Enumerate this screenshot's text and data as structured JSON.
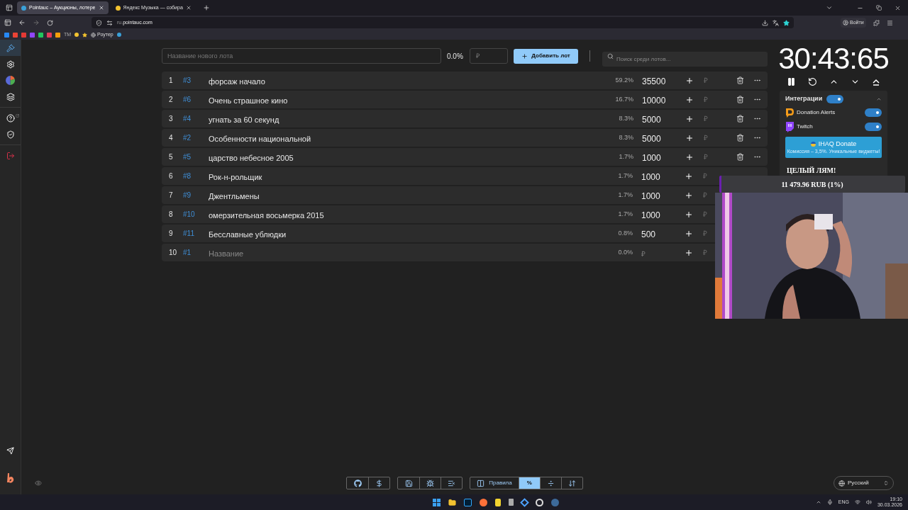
{
  "browser": {
    "tabs": [
      {
        "title": "Pointauc – Аукционы, лотере",
        "selected": true
      },
      {
        "title": "Яндекс Музыка — собира",
        "selected": false
      }
    ],
    "url_prefix": "ru.",
    "url_domain": "pointauc.com",
    "bookmarks": [
      {
        "label": "ТМ"
      },
      {
        "label": "Роутер"
      }
    ],
    "sign_in": "Войти"
  },
  "sidebar": {
    "items": [
      {
        "kind": "auction",
        "selected": true
      },
      {
        "kind": "settings",
        "selected": false
      },
      {
        "kind": "stats",
        "selected": false
      },
      {
        "kind": "layers",
        "selected": false
      },
      {
        "kind": "help",
        "selected": false
      },
      {
        "kind": "shield",
        "selected": false
      },
      {
        "kind": "logout",
        "selected": false
      }
    ]
  },
  "new_lot": {
    "placeholder": "Название нового лота",
    "percent": "0.0%",
    "amount_placeholder": "₽",
    "add_button": "Добавить лот",
    "search_placeholder": "Поиск среди лотов..."
  },
  "lots": [
    {
      "num": "1",
      "id": "#3",
      "name": "форсаж начало",
      "percent": "59.2%",
      "amount": "35500",
      "add_placeholder": "₽",
      "actions_hidden": false
    },
    {
      "num": "2",
      "id": "#6",
      "name": "Очень страшное кино",
      "percent": "16.7%",
      "amount": "10000",
      "add_placeholder": "₽",
      "actions_hidden": false
    },
    {
      "num": "3",
      "id": "#4",
      "name": "угнать за 60 секунд",
      "percent": "8.3%",
      "amount": "5000",
      "add_placeholder": "₽",
      "actions_hidden": false
    },
    {
      "num": "4",
      "id": "#2",
      "name": "Особенности национальной",
      "percent": "8.3%",
      "amount": "5000",
      "add_placeholder": "₽",
      "actions_hidden": false
    },
    {
      "num": "5",
      "id": "#5",
      "name": "царство небесное 2005",
      "percent": "1.7%",
      "amount": "1000",
      "add_placeholder": "₽",
      "actions_hidden": false
    },
    {
      "num": "6",
      "id": "#8",
      "name": "Рок-н-рольщик",
      "percent": "1.7%",
      "amount": "1000",
      "add_placeholder": "₽",
      "actions_hidden": true
    },
    {
      "num": "7",
      "id": "#9",
      "name": "Джентльмены",
      "percent": "1.7%",
      "amount": "1000",
      "add_placeholder": "₽",
      "actions_hidden": true
    },
    {
      "num": "8",
      "id": "#10",
      "name": "омерзительная восьмерка 2015",
      "percent": "1.7%",
      "amount": "1000",
      "add_placeholder": "₽",
      "actions_hidden": true
    },
    {
      "num": "9",
      "id": "#11",
      "name": "Бесславные ублюдки",
      "percent": "0.8%",
      "amount": "500",
      "add_placeholder": "₽",
      "actions_hidden": true
    },
    {
      "num": "10",
      "id": "#1",
      "name_placeholder": "Название",
      "percent": "0.0%",
      "amount_placeholder": "₽",
      "add_placeholder": "₽",
      "actions_hidden": true
    }
  ],
  "timer": "30:43:65",
  "integrations": {
    "title": "Интеграции",
    "on": true,
    "expanded": true,
    "items": [
      {
        "kind": "donationalerts",
        "name": "Donation Alerts",
        "on": true
      },
      {
        "kind": "twitch",
        "name": "Twitch",
        "on": true
      }
    ],
    "promo": {
      "title": "IHAQ Donate",
      "subtitle": "Комиссия – 3,5%. Уникальные виджеты!"
    }
  },
  "stream_overlay": {
    "goal_title": "ЦЕЛЫЙ ЛЯМ!",
    "goal_amount": "11 479.96 RUB (1%)",
    "level": 0.01
  },
  "toolbar": {
    "groups": [
      [
        {
          "kind": "github",
          "selected": false
        },
        {
          "kind": "dollar",
          "selected": false
        }
      ],
      [
        {
          "kind": "save",
          "selected": false
        },
        {
          "kind": "bug",
          "selected": false
        },
        {
          "kind": "clear",
          "selected": false
        }
      ],
      [
        {
          "kind": "rules",
          "label": "Правила",
          "selected": false
        },
        {
          "kind": "percent",
          "label": "%",
          "selected": true
        },
        {
          "kind": "divide",
          "selected": false
        },
        {
          "kind": "sort",
          "selected": false
        }
      ]
    ]
  },
  "language": "Русский",
  "taskbar": {
    "lang": "ENG",
    "time": "19:10",
    "date": "30.03.2026"
  }
}
